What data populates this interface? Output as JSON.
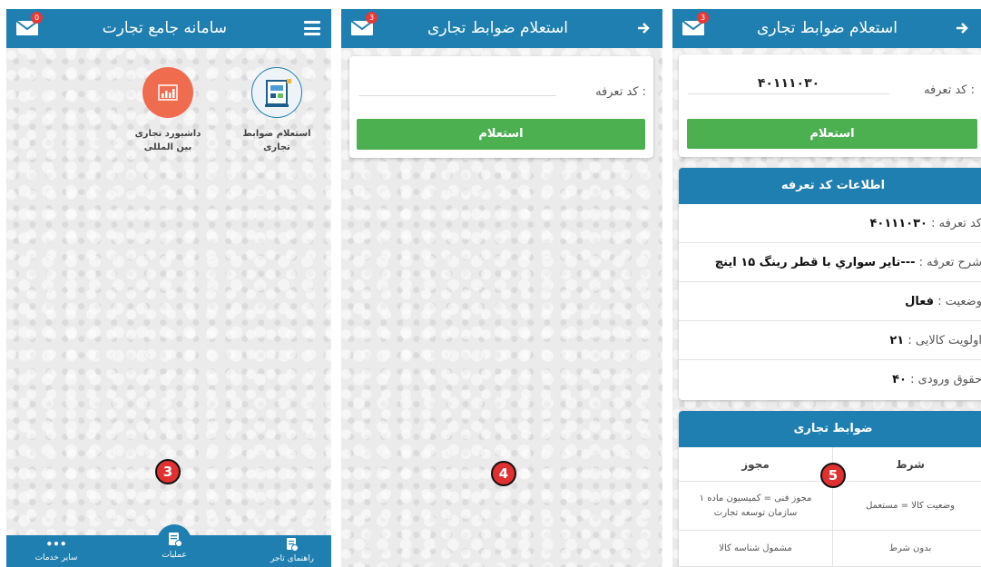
{
  "colors": {
    "header": "#1f7fb0",
    "green": "#4caf50",
    "badge": "#e53935",
    "orange_icon": "#ef6c4f"
  },
  "screen1": {
    "title": "سامانه جامع تجارت",
    "mail_badge": "0",
    "services": [
      {
        "label": "استعلام ضوابط تجاری",
        "icon": "regulations-icon"
      },
      {
        "label": "داشبورد تجاری بین المللی",
        "icon": "dashboard-chart-icon"
      }
    ],
    "step_number": "3",
    "bottom_nav": {
      "right_label": "راهنمای تاجر",
      "center_label": "عملیات",
      "left_label": "سایر خدمات",
      "left_dots": "•••"
    }
  },
  "screen2": {
    "title": "استعلام ضوابط تجاری",
    "mail_badge": "3",
    "tariff_label": "کد تعرفه :",
    "tariff_value": "",
    "inquiry_button": "استعلام",
    "step_number": "4"
  },
  "screen3": {
    "title": "استعلام ضوابط تجاری",
    "mail_badge": "3",
    "tariff_label": "کد تعرفه :",
    "tariff_value": "۴۰۱۱۱۰۳۰",
    "inquiry_button": "استعلام",
    "info_card": {
      "header": "اطلاعات کد تعرفه",
      "rows": [
        {
          "key": "کد تعرفه : ",
          "value": "۴۰۱۱۱۰۳۰"
        },
        {
          "key": "شرح تعرفه : ",
          "value": "---تایر سواري با قطر رینگ ۱۵ اینچ"
        },
        {
          "key": "وضعیت : ",
          "value": "فعال"
        },
        {
          "key": "اولویت کالایی : ",
          "value": "۲۱"
        },
        {
          "key": "حقوق ورودی : ",
          "value": "۴۰"
        }
      ]
    },
    "rules_card": {
      "header": "ضوابط تجاری",
      "col_condition": "شرط",
      "col_license": "مجوز",
      "rows": [
        {
          "condition": "وضعیت کالا = مستعمل",
          "license": "مجوز فنی = کمیسیون ماده ۱ سازمان توسعه تجارت"
        },
        {
          "condition": "بدون شرط",
          "license": "مشمول شناسه کالا"
        }
      ]
    },
    "step_number": "5"
  }
}
